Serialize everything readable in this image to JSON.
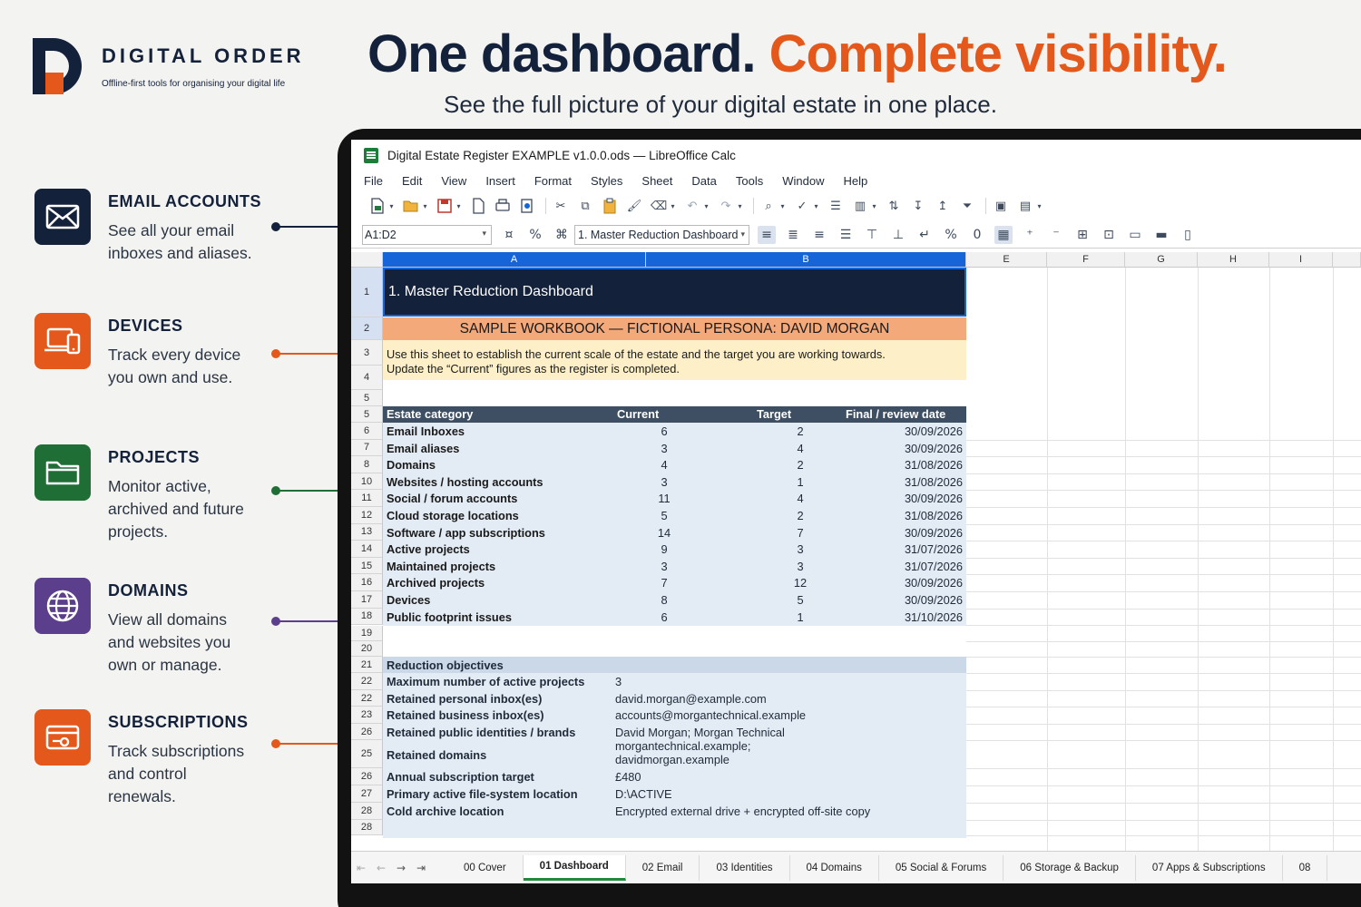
{
  "brand": {
    "name": "DIGITAL ORDER",
    "tagline": "Offline-first tools for organising your digital life"
  },
  "headline": {
    "part1": "One dashboard.",
    "part2": "Complete visibility.",
    "subtitle": "See the full picture of your digital estate in one place."
  },
  "features": [
    {
      "title": "EMAIL ACCOUNTS",
      "line1": "See all your email",
      "line2": "inboxes and aliases.",
      "line3": "",
      "color": "#14213a",
      "icon": "envelope-icon"
    },
    {
      "title": "DEVICES",
      "line1": "Track every device",
      "line2": "you own and use.",
      "line3": "",
      "color": "#e4591b",
      "icon": "devices-icon"
    },
    {
      "title": "PROJECTS",
      "line1": "Monitor active,",
      "line2": "archived and future",
      "line3": "projects.",
      "color": "#1f6e35",
      "icon": "folder-icon"
    },
    {
      "title": "DOMAINS",
      "line1": "View all domains",
      "line2": "and websites you",
      "line3": "own or manage.",
      "color": "#5b3f8c",
      "icon": "globe-icon"
    },
    {
      "title": "SUBSCRIPTIONS",
      "line1": "Track subscriptions",
      "line2": "and control",
      "line3": "renewals.",
      "color": "#e4591b",
      "icon": "card-icon"
    }
  ],
  "window": {
    "title": "Digital Estate Register EXAMPLE v1.0.0.ods — LibreOffice Calc",
    "menu": [
      "File",
      "Edit",
      "View",
      "Insert",
      "Format",
      "Styles",
      "Sheet",
      "Data",
      "Tools",
      "Window",
      "Help"
    ],
    "name_box": "A1:D2",
    "style_box": "1. Master Reduction Dashboard"
  },
  "columns": [
    "A",
    "B",
    "E",
    "F",
    "G",
    "H",
    "I"
  ],
  "rows": [
    "1",
    "2",
    "3",
    "4",
    "5",
    "5",
    "6",
    "7",
    "8",
    "10",
    "11",
    "12",
    "13",
    "14",
    "15",
    "16",
    "17",
    "18",
    "19",
    "20",
    "21",
    "22",
    "22",
    "23",
    "26",
    "25",
    "26",
    "27",
    "28",
    "28"
  ],
  "sheet": {
    "banner": "1. Master Reduction Dashboard",
    "persona": "SAMPLE WORKBOOK — FICTIONAL PERSONA: DAVID MORGAN",
    "note_line1": "Use this sheet to establish the current scale of the estate and the target you are working towards.",
    "note_line2": "Update the “Current” figures as the register is completed.",
    "table_headers": [
      "Estate category",
      "Current",
      "Target",
      "Final / review date"
    ],
    "table_rows": [
      [
        "Email Inboxes",
        "6",
        "2",
        "30/09/2026"
      ],
      [
        "Email aliases",
        "3",
        "4",
        "30/09/2026"
      ],
      [
        "Domains",
        "4",
        "2",
        "31/08/2026"
      ],
      [
        "Websites / hosting accounts",
        "3",
        "1",
        "31/08/2026"
      ],
      [
        "Social / forum accounts",
        "11",
        "4",
        "30/09/2026"
      ],
      [
        "Cloud storage locations",
        "5",
        "2",
        "31/08/2026"
      ],
      [
        "Software / app subscriptions",
        "14",
        "7",
        "30/09/2026"
      ],
      [
        "Active projects",
        "9",
        "3",
        "31/07/2026"
      ],
      [
        "Maintained projects",
        "3",
        "3",
        "31/07/2026"
      ],
      [
        "Archived projects",
        "7",
        "12",
        "30/09/2026"
      ],
      [
        "Devices",
        "8",
        "5",
        "30/09/2026"
      ],
      [
        "Public footprint issues",
        "6",
        "1",
        "31/10/2026"
      ]
    ],
    "objectives_title": "Reduction objectives",
    "objectives": [
      [
        "Maximum number of active projects",
        "3",
        ""
      ],
      [
        "Retained personal inbox(es)",
        "david.morgan@example.com",
        ""
      ],
      [
        "Retained business inbox(es)",
        "accounts@morgantechnical.example",
        ""
      ],
      [
        "Retained public identities / brands",
        "David Morgan; Morgan Technical",
        ""
      ],
      [
        "Retained domains",
        "morgantechnical.example;",
        "davidmorgan.example"
      ],
      [
        "Annual subscription target",
        "£480",
        ""
      ],
      [
        "Primary active file-system location",
        "D:\\ACTIVE",
        ""
      ],
      [
        "Cold archive location",
        "Encrypted external drive + encrypted off-site copy",
        ""
      ]
    ]
  },
  "tabs": [
    "00 Cover",
    "01 Dashboard",
    "02 Email",
    "03 Identities",
    "04 Domains",
    "05 Social & Forums",
    "06 Storage & Backup",
    "07 Apps & Subscriptions",
    "08"
  ]
}
